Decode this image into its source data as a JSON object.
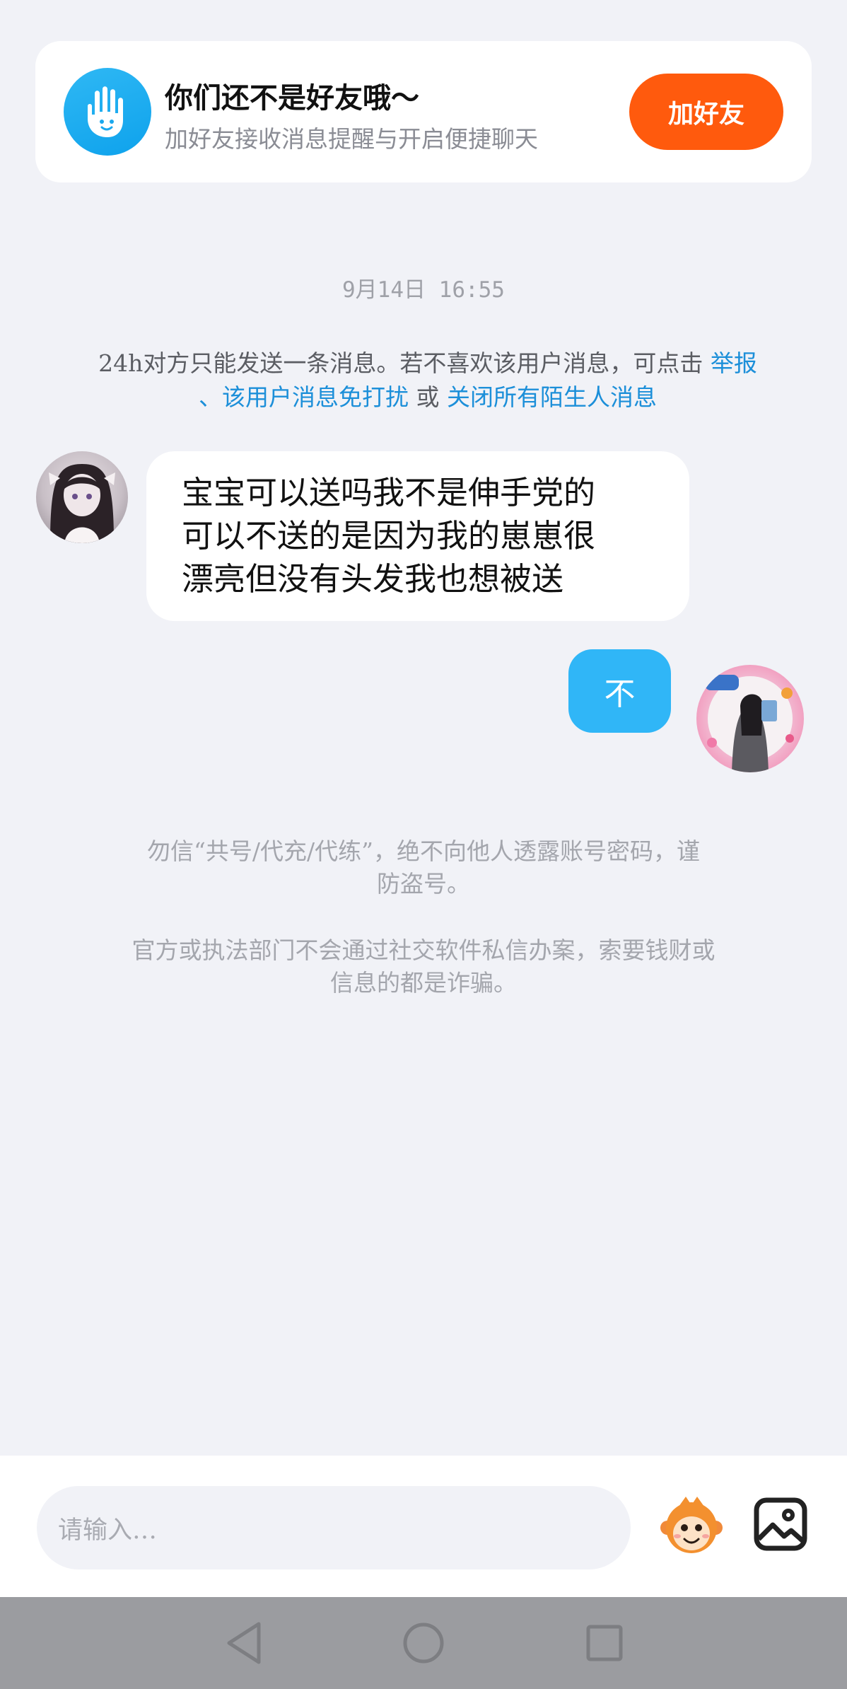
{
  "banner": {
    "title": "你们还不是好友哦～",
    "subtitle": "加好友接收消息提醒与开启便捷聊天",
    "add_button": "加好友",
    "icon": "waving-hand-icon"
  },
  "chat": {
    "timestamp": "9月14日  16:55",
    "notice": {
      "text": "24h对方只能发送一条消息。若不喜欢该用户消息，可点击 ",
      "link_report": "举报",
      "sep": "、",
      "link_mute": "该用户消息免打扰",
      "or": " 或 ",
      "link_close_all": "关闭所有陌生人消息"
    },
    "messages": [
      {
        "side": "left",
        "line1": "宝宝可以送吗我不是伸手党的",
        "line2": "可以不送的是因为我的崽崽很",
        "line3": "漂亮但没有头发我也想被送"
      },
      {
        "side": "right",
        "text": "不"
      }
    ],
    "safety_tips": [
      {
        "line1": "勿信“共号/代充/代练”，绝不向他人透露账号密码，谨",
        "line2": "防盗号。"
      },
      {
        "line1": "官方或执法部门不会通过社交软件私信办案，索要钱财或",
        "line2": "信息的都是诈骗。"
      }
    ]
  },
  "input": {
    "placeholder": "请输入…"
  },
  "colors": {
    "accent_blue": "#30b6f7",
    "add_friend_orange": "#ff5a0d",
    "link_blue": "#1c8fd9",
    "background": "#f1f2f7"
  }
}
